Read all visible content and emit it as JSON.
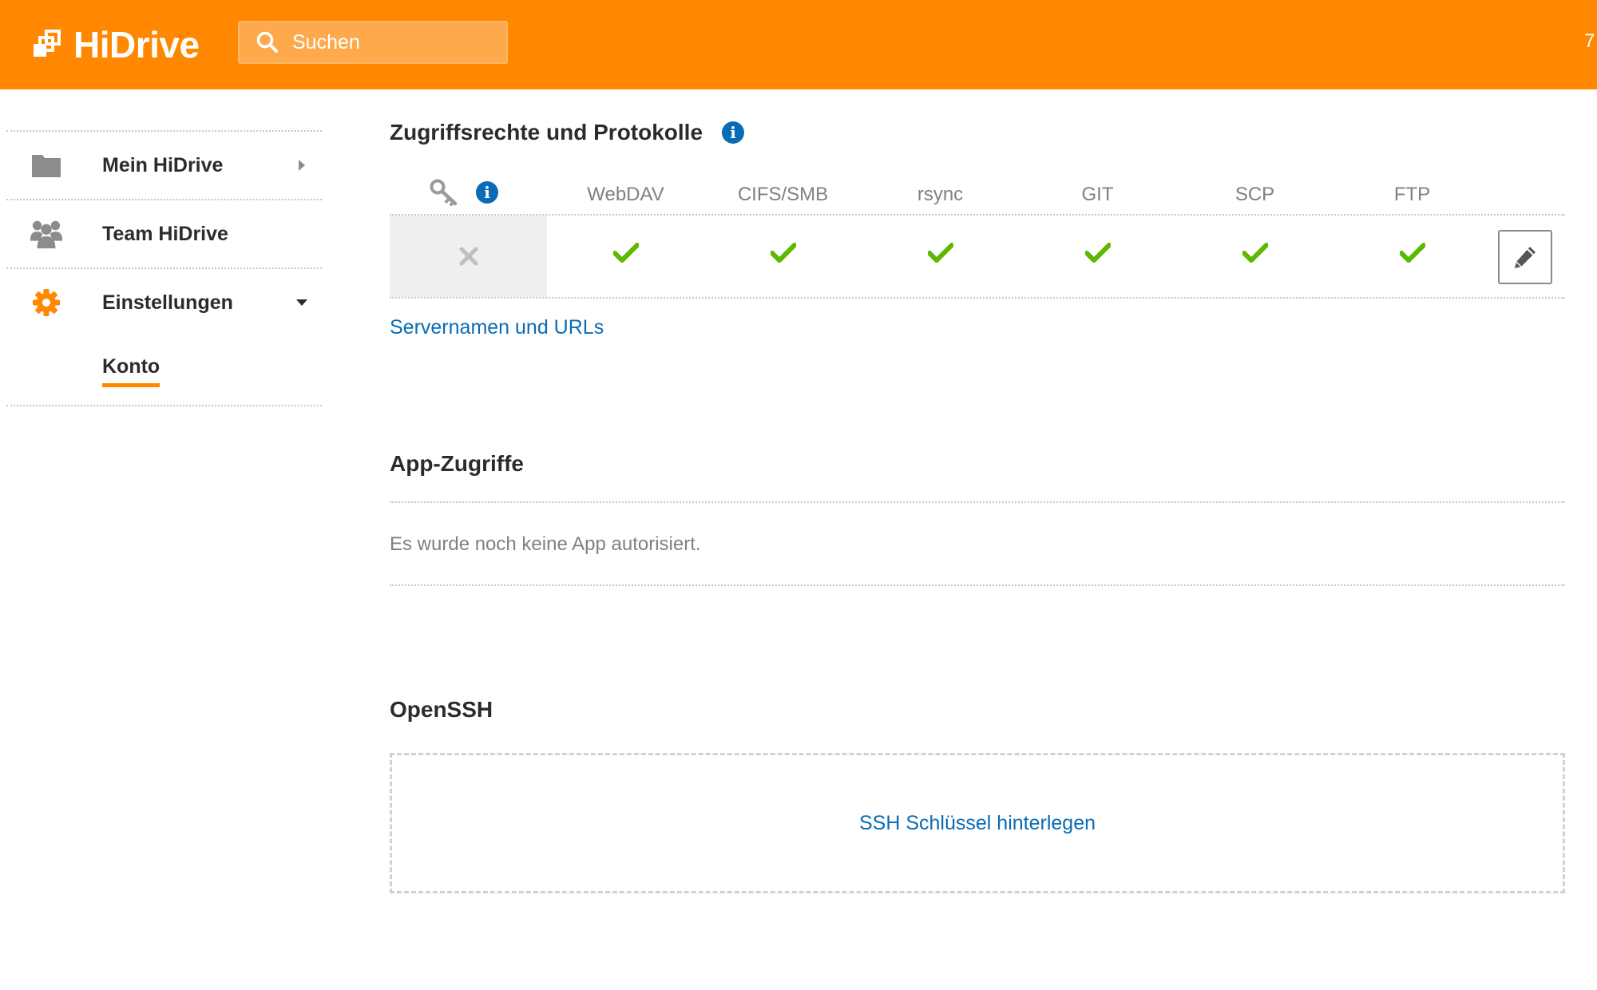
{
  "header": {
    "brand": "HiDrive",
    "search_placeholder": "Suchen",
    "right_text": "7",
    "accent_color": "#ff8800"
  },
  "sidebar": {
    "items": [
      {
        "label": "Mein HiDrive",
        "icon": "folder-icon",
        "arrow": "chevron-right-icon"
      },
      {
        "label": "Team HiDrive",
        "icon": "team-icon"
      },
      {
        "label": "Einstellungen",
        "icon": "gear-icon",
        "arrow": "caret-down-icon"
      }
    ],
    "subitems": [
      {
        "label": "Konto",
        "active": true
      }
    ]
  },
  "main": {
    "protocols": {
      "title": "Zugriffsrechte und Protokolle",
      "columns": [
        "WebDAV",
        "CIFS/SMB",
        "rsync",
        "GIT",
        "SCP",
        "FTP"
      ],
      "key_enabled": false,
      "enabled": [
        true,
        true,
        true,
        true,
        true,
        true
      ],
      "servers_link": "Servernamen und URLs"
    },
    "apps": {
      "title": "App-Zugriffe",
      "empty_text": "Es wurde noch keine App autorisiert."
    },
    "openssh": {
      "title": "OpenSSH",
      "add_key_link": "SSH Schlüssel hinterlegen"
    },
    "colors": {
      "link": "#0a6cb5",
      "check": "#5cb800",
      "cross": "#bfbfbf"
    }
  }
}
